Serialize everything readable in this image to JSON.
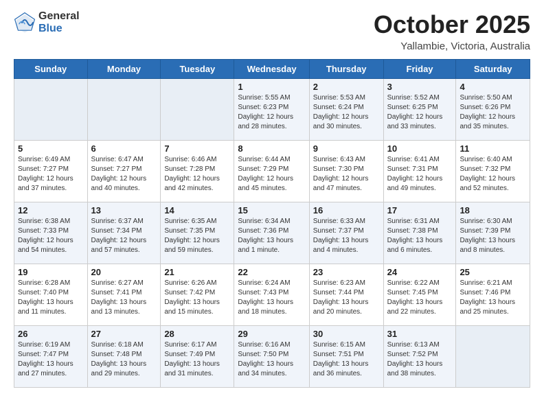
{
  "logo": {
    "general": "General",
    "blue": "Blue"
  },
  "header": {
    "month": "October 2025",
    "location": "Yallambie, Victoria, Australia"
  },
  "weekdays": [
    "Sunday",
    "Monday",
    "Tuesday",
    "Wednesday",
    "Thursday",
    "Friday",
    "Saturday"
  ],
  "weeks": [
    [
      {
        "day": "",
        "info": ""
      },
      {
        "day": "",
        "info": ""
      },
      {
        "day": "",
        "info": ""
      },
      {
        "day": "1",
        "info": "Sunrise: 5:55 AM\nSunset: 6:23 PM\nDaylight: 12 hours\nand 28 minutes."
      },
      {
        "day": "2",
        "info": "Sunrise: 5:53 AM\nSunset: 6:24 PM\nDaylight: 12 hours\nand 30 minutes."
      },
      {
        "day": "3",
        "info": "Sunrise: 5:52 AM\nSunset: 6:25 PM\nDaylight: 12 hours\nand 33 minutes."
      },
      {
        "day": "4",
        "info": "Sunrise: 5:50 AM\nSunset: 6:26 PM\nDaylight: 12 hours\nand 35 minutes."
      }
    ],
    [
      {
        "day": "5",
        "info": "Sunrise: 6:49 AM\nSunset: 7:27 PM\nDaylight: 12 hours\nand 37 minutes."
      },
      {
        "day": "6",
        "info": "Sunrise: 6:47 AM\nSunset: 7:27 PM\nDaylight: 12 hours\nand 40 minutes."
      },
      {
        "day": "7",
        "info": "Sunrise: 6:46 AM\nSunset: 7:28 PM\nDaylight: 12 hours\nand 42 minutes."
      },
      {
        "day": "8",
        "info": "Sunrise: 6:44 AM\nSunset: 7:29 PM\nDaylight: 12 hours\nand 45 minutes."
      },
      {
        "day": "9",
        "info": "Sunrise: 6:43 AM\nSunset: 7:30 PM\nDaylight: 12 hours\nand 47 minutes."
      },
      {
        "day": "10",
        "info": "Sunrise: 6:41 AM\nSunset: 7:31 PM\nDaylight: 12 hours\nand 49 minutes."
      },
      {
        "day": "11",
        "info": "Sunrise: 6:40 AM\nSunset: 7:32 PM\nDaylight: 12 hours\nand 52 minutes."
      }
    ],
    [
      {
        "day": "12",
        "info": "Sunrise: 6:38 AM\nSunset: 7:33 PM\nDaylight: 12 hours\nand 54 minutes."
      },
      {
        "day": "13",
        "info": "Sunrise: 6:37 AM\nSunset: 7:34 PM\nDaylight: 12 hours\nand 57 minutes."
      },
      {
        "day": "14",
        "info": "Sunrise: 6:35 AM\nSunset: 7:35 PM\nDaylight: 12 hours\nand 59 minutes."
      },
      {
        "day": "15",
        "info": "Sunrise: 6:34 AM\nSunset: 7:36 PM\nDaylight: 13 hours\nand 1 minute."
      },
      {
        "day": "16",
        "info": "Sunrise: 6:33 AM\nSunset: 7:37 PM\nDaylight: 13 hours\nand 4 minutes."
      },
      {
        "day": "17",
        "info": "Sunrise: 6:31 AM\nSunset: 7:38 PM\nDaylight: 13 hours\nand 6 minutes."
      },
      {
        "day": "18",
        "info": "Sunrise: 6:30 AM\nSunset: 7:39 PM\nDaylight: 13 hours\nand 8 minutes."
      }
    ],
    [
      {
        "day": "19",
        "info": "Sunrise: 6:28 AM\nSunset: 7:40 PM\nDaylight: 13 hours\nand 11 minutes."
      },
      {
        "day": "20",
        "info": "Sunrise: 6:27 AM\nSunset: 7:41 PM\nDaylight: 13 hours\nand 13 minutes."
      },
      {
        "day": "21",
        "info": "Sunrise: 6:26 AM\nSunset: 7:42 PM\nDaylight: 13 hours\nand 15 minutes."
      },
      {
        "day": "22",
        "info": "Sunrise: 6:24 AM\nSunset: 7:43 PM\nDaylight: 13 hours\nand 18 minutes."
      },
      {
        "day": "23",
        "info": "Sunrise: 6:23 AM\nSunset: 7:44 PM\nDaylight: 13 hours\nand 20 minutes."
      },
      {
        "day": "24",
        "info": "Sunrise: 6:22 AM\nSunset: 7:45 PM\nDaylight: 13 hours\nand 22 minutes."
      },
      {
        "day": "25",
        "info": "Sunrise: 6:21 AM\nSunset: 7:46 PM\nDaylight: 13 hours\nand 25 minutes."
      }
    ],
    [
      {
        "day": "26",
        "info": "Sunrise: 6:19 AM\nSunset: 7:47 PM\nDaylight: 13 hours\nand 27 minutes."
      },
      {
        "day": "27",
        "info": "Sunrise: 6:18 AM\nSunset: 7:48 PM\nDaylight: 13 hours\nand 29 minutes."
      },
      {
        "day": "28",
        "info": "Sunrise: 6:17 AM\nSunset: 7:49 PM\nDaylight: 13 hours\nand 31 minutes."
      },
      {
        "day": "29",
        "info": "Sunrise: 6:16 AM\nSunset: 7:50 PM\nDaylight: 13 hours\nand 34 minutes."
      },
      {
        "day": "30",
        "info": "Sunrise: 6:15 AM\nSunset: 7:51 PM\nDaylight: 13 hours\nand 36 minutes."
      },
      {
        "day": "31",
        "info": "Sunrise: 6:13 AM\nSunset: 7:52 PM\nDaylight: 13 hours\nand 38 minutes."
      },
      {
        "day": "",
        "info": ""
      }
    ]
  ]
}
